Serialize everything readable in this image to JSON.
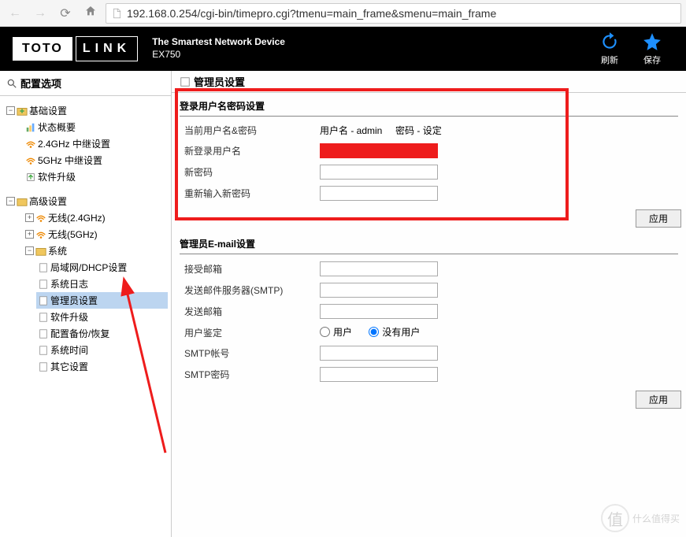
{
  "browser": {
    "url": "192.168.0.254/cgi-bin/timepro.cgi?tmenu=main_frame&smenu=main_frame"
  },
  "header": {
    "logo_left": "TOTO",
    "logo_right": "LINK",
    "tagline": "The Smartest Network Device",
    "model": "EX750",
    "refresh": "刷新",
    "save": "保存"
  },
  "sidebar": {
    "title": "配置选项",
    "basic": {
      "label": "基础设置",
      "items": [
        "状态概要",
        "2.4GHz 中继设置",
        "5GHz 中继设置",
        "软件升级"
      ]
    },
    "advanced": {
      "label": "高级设置",
      "wireless24": "无线(2.4GHz)",
      "wireless5": "无线(5GHz)",
      "system": {
        "label": "系统",
        "items": [
          "局域网/DHCP设置",
          "系统日志",
          "管理员设置",
          "软件升级",
          "配置备份/恢复",
          "系统时间",
          "其它设置"
        ]
      }
    }
  },
  "content": {
    "title": "管理员设置",
    "panel1": {
      "title": "登录用户名密码设置",
      "row_current_label": "当前用户名&密码",
      "row_current_val_user": "用户名 - admin",
      "row_current_val_pass": "密码 - 设定",
      "row_newuser": "新登录用户名",
      "row_newpass": "新密码",
      "row_repass": "重新输入新密码",
      "apply": "应用"
    },
    "panel2": {
      "title": "管理员E-mail设置",
      "row_recv": "接受邮箱",
      "row_smtp_srv": "发送邮件服务器(SMTP)",
      "row_send": "发送邮箱",
      "row_auth": "用户鉴定",
      "auth_user": "用户",
      "auth_none": "没有用户",
      "row_smtp_acc": "SMTP帐号",
      "row_smtp_pwd": "SMTP密码",
      "apply": "应用"
    }
  },
  "watermark": {
    "zhi": "值",
    "text": "什么值得买"
  }
}
